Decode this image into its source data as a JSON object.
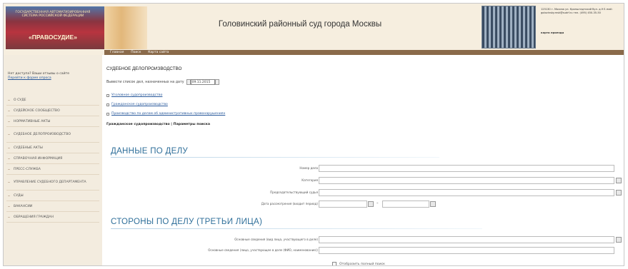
{
  "header": {
    "logo_small": "ГОСУДАРСТВЕННАЯ АВТОМАТИЗИРОВАННАЯ СИСТЕМА РОССИЙСКОЙ ФЕДЕРАЦИИ",
    "logo_big": "«ПРАВОСУДИЕ»",
    "court_name": "Головинский районный суд города Москвы",
    "address": "125130 г. Москва ул. Кронштадтский бул. д.9 Е-mail: golovinsky.msk@sudrf.ru тел. (495) 450-35-50",
    "map_link": "карта проезда",
    "nav": [
      "Главная",
      "Поиск",
      "Карта сайта"
    ]
  },
  "sidebar": {
    "notice": "Нет доступа? Ваши отзывы о сайте",
    "notice_link": "Перейти к форме опроса",
    "items": [
      "О СУДЕ",
      "СУДЕЙСКОЕ СООБЩЕСТВО",
      "НОРМАТИВНЫЕ АКТЫ",
      "СУДЕБНОЕ ДЕЛОПРОИЗВОДСТВО",
      "СУДЕБНЫЕ АКТЫ",
      "СПРАВОЧНАЯ ИНФОРМАЦИЯ",
      "ПРЕСС-СЛУЖБА",
      "УПРАВЛЕНИЕ СУДЕБНОГО ДЕПАРТАМЕНТА",
      "СУДЫ",
      "ВАКАНСИИ",
      "ОБРАЩЕНИЯ ГРАЖДАН"
    ]
  },
  "main": {
    "title": "СУДЕБНОЕ ДЕЛОПРОИЗВОДСТВО",
    "date_label": "Вывести список дел, назначенных на дату",
    "date_value": "09.11.2015",
    "links": [
      "Уголовное судопроизводство",
      "Гражданское судопроизводство",
      "Производство по делам об административных правонарушениях"
    ],
    "breadcrumb": "Гражданское судопроизводство | Параметры поиска",
    "section1": "ДАННЫЕ ПО ДЕЛУ",
    "fields1": [
      "Номер дела",
      "Категория",
      "Председательствующий судья",
      "Дата рассмотрения (входит период)"
    ],
    "section2": "СТОРОНЫ ПО ДЕЛУ (ТРЕТЬИ ЛИЦА)",
    "fields2": [
      "Основные сведения (вид лица, участвующего в деле)",
      "Основные сведения (лицо, участвующее в деле (ФИО, наименование))"
    ],
    "checkbox_label": "Отобразить полный поиск"
  }
}
